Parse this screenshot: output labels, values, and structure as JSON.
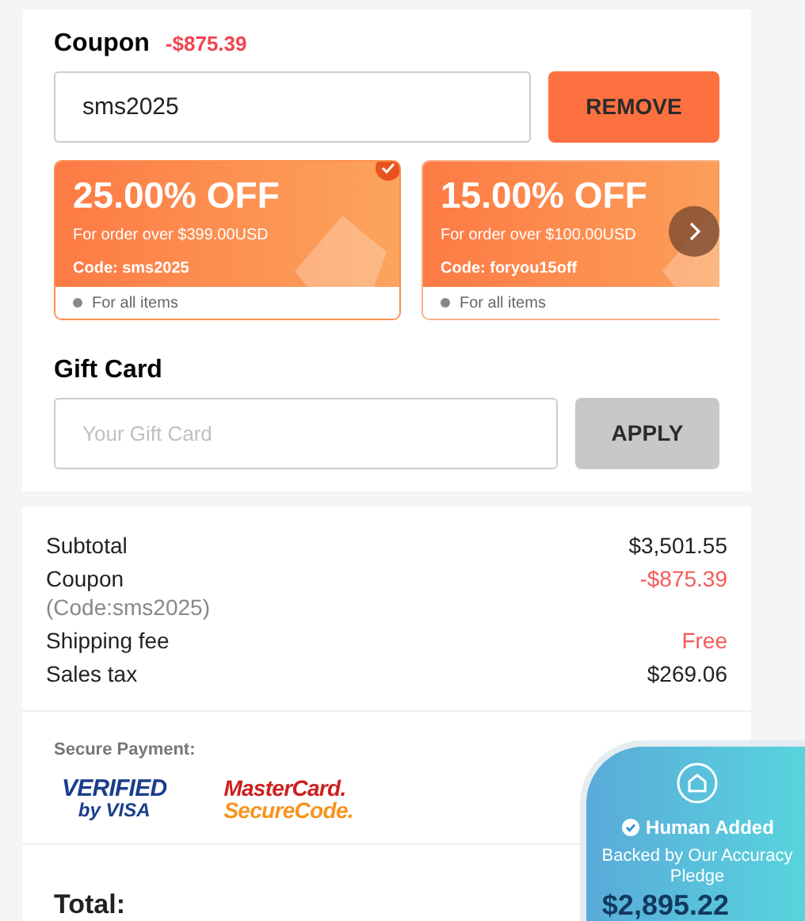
{
  "coupon": {
    "title": "Coupon",
    "discount": "-$875.39",
    "value": "sms2025",
    "button": "REMOVE",
    "cards": [
      {
        "headline": "25.00% OFF",
        "condition": "For order over $399.00USD",
        "code": "Code: sms2025",
        "scope": "For all items",
        "selected": true
      },
      {
        "headline": "15.00% OFF",
        "condition": "For order over $100.00USD",
        "code": "Code: foryou15off",
        "scope": "For all items",
        "selected": false
      }
    ]
  },
  "gift_card": {
    "title": "Gift Card",
    "placeholder": "Your Gift Card",
    "button": "APPLY"
  },
  "summary": [
    {
      "label": "Subtotal",
      "value": "$3,501.55",
      "highlight": false
    },
    {
      "label": "Coupon",
      "note": "(Code:sms2025)",
      "value": "-$875.39",
      "highlight": true
    },
    {
      "label": "Shipping fee",
      "value": "Free",
      "highlight": true
    },
    {
      "label": "Sales tax",
      "value": "$269.06",
      "highlight": false
    }
  ],
  "secure_payment": {
    "title": "Secure Payment:",
    "visa": [
      "VERIFIED",
      "by",
      "VISA"
    ],
    "mastercard": [
      "MasterCard.",
      "SecureCode."
    ]
  },
  "total": {
    "label": "Total:",
    "value": "$2,895.22"
  },
  "badge": {
    "title": "Human Added",
    "subtitle": "Backed by Our Accuracy Pledge"
  }
}
